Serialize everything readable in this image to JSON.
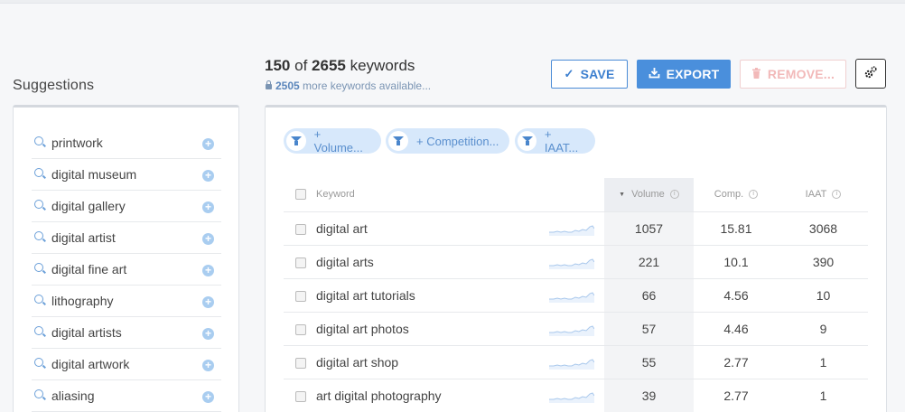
{
  "suggestions": {
    "title": "Suggestions",
    "items": [
      {
        "label": "printwork"
      },
      {
        "label": "digital museum"
      },
      {
        "label": "digital gallery"
      },
      {
        "label": "digital artist"
      },
      {
        "label": "digital fine art"
      },
      {
        "label": "lithography"
      },
      {
        "label": "digital artists"
      },
      {
        "label": "digital artwork"
      },
      {
        "label": "aliasing"
      }
    ]
  },
  "header": {
    "shown": "150",
    "of": "of",
    "total": "2655",
    "unit": "keywords",
    "more_count": "2505",
    "more_text": "more keywords available..."
  },
  "toolbar": {
    "save_label": "SAVE",
    "export_label": "EXPORT",
    "remove_label": "REMOVE..."
  },
  "filters": [
    {
      "label": "+ Volume..."
    },
    {
      "label": "+ Competition..."
    },
    {
      "label": "+ IAAT..."
    }
  ],
  "table": {
    "columns": {
      "keyword": "Keyword",
      "volume": "Volume",
      "comp": "Comp.",
      "iaat": "IAAT"
    },
    "rows": [
      {
        "keyword": "digital art",
        "volume": "1057",
        "comp": "15.81",
        "iaat": "3068"
      },
      {
        "keyword": "digital arts",
        "volume": "221",
        "comp": "10.1",
        "iaat": "390"
      },
      {
        "keyword": "digital art tutorials",
        "volume": "66",
        "comp": "4.56",
        "iaat": "10"
      },
      {
        "keyword": "digital art photos",
        "volume": "57",
        "comp": "4.46",
        "iaat": "9"
      },
      {
        "keyword": "digital art shop",
        "volume": "55",
        "comp": "2.77",
        "iaat": "1"
      },
      {
        "keyword": "art digital photography",
        "volume": "39",
        "comp": "2.77",
        "iaat": "1"
      }
    ]
  },
  "colors": {
    "accent": "#4a8fdc",
    "filter_bg": "#d7e8fb",
    "remove_disabled": "#f2b9b9",
    "trend": "#a9c8ec"
  }
}
